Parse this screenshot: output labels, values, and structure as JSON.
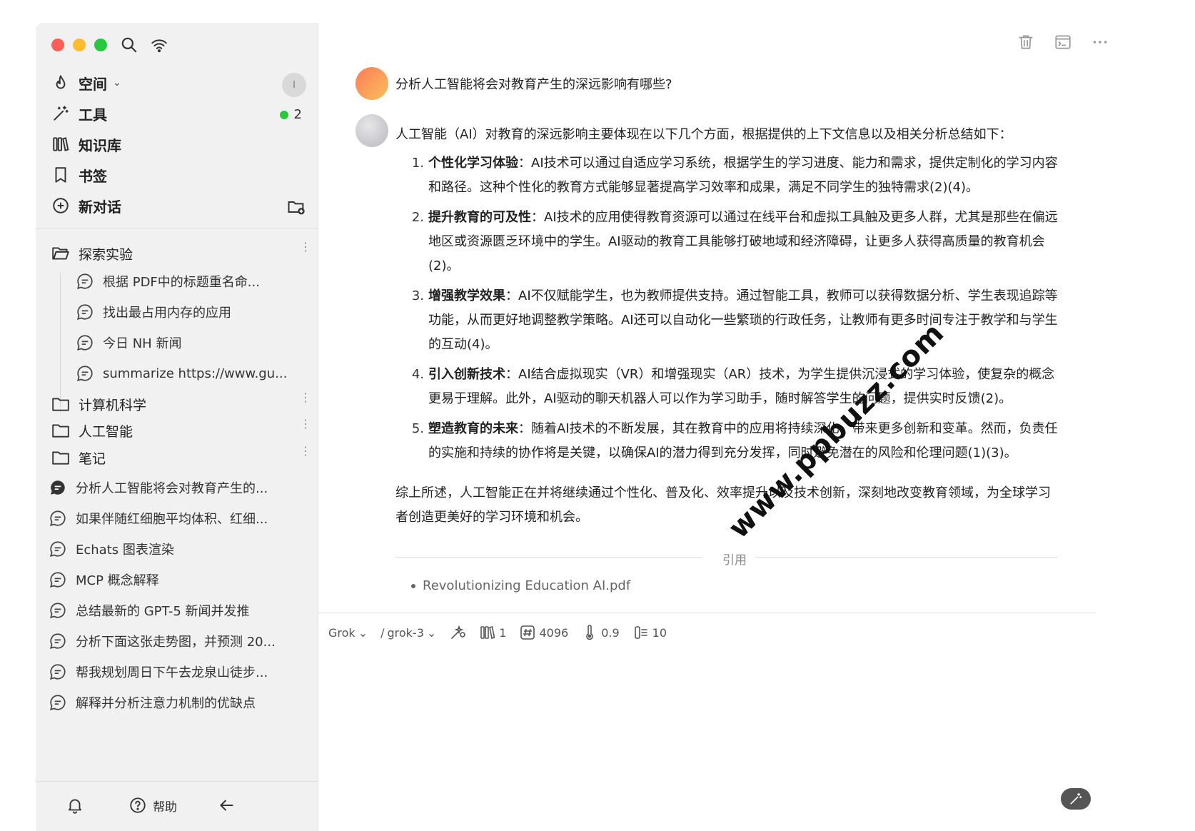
{
  "sidebar": {
    "nav": {
      "space": "空间",
      "tools": "工具",
      "knowledge": "知识库",
      "bookmarks": "书签",
      "new_chat": "新对话"
    },
    "avatar_initial": "I",
    "tools_count": "2",
    "folders": [
      {
        "name": "探索实验"
      },
      {
        "name": "计算机科学"
      },
      {
        "name": "人工智能"
      },
      {
        "name": "笔记"
      }
    ],
    "sub_chats": [
      "根据 PDF中的标题重名命...",
      "找出最占用内存的应用",
      "今日 NH 新闻",
      "summarize https://www.gu..."
    ],
    "chats": [
      "分析人工智能将会对教育产生的...",
      "如果伴随红细胞平均体积、红细...",
      "Echats 图表渲染",
      "MCP 概念解释",
      "总结最新的 GPT-5 新闻并发推",
      "分析下面这张走势图，并预测 20...",
      "帮我规划周日下午去龙泉山徒步...",
      "解释并分析注意力机制的优缺点"
    ],
    "footer": {
      "help": "帮助"
    }
  },
  "main": {
    "question": "分析人工智能将会对教育产生的深远影响有哪些?",
    "answer": {
      "intro": "人工智能（AI）对教育的深远影响主要体现在以下几个方面，根据提供的上下文信息以及相关分析总结如下：",
      "items": [
        {
          "num": "1.",
          "title": "个性化学习体验",
          "text": "：AI技术可以通过自适应学习系统，根据学生的学习进度、能力和需求，提供定制化的学习内容和路径。这种个性化的教育方式能够显著提高学习效率和成果，满足不同学生的独特需求(2)(4)。"
        },
        {
          "num": "2.",
          "title": "提升教育的可及性",
          "text": "：AI技术的应用使得教育资源可以通过在线平台和虚拟工具触及更多人群，尤其是那些在偏远地区或资源匮乏环境中的学生。AI驱动的教育工具能够打破地域和经济障碍，让更多人获得高质量的教育机会(2)。"
        },
        {
          "num": "3.",
          "title": "增强教学效果",
          "text": "：AI不仅赋能学生，也为教师提供支持。通过智能工具，教师可以获得数据分析、学生表现追踪等功能，从而更好地调整教学策略。AI还可以自动化一些繁琐的行政任务，让教师有更多时间专注于教学和与学生的互动(4)。"
        },
        {
          "num": "4.",
          "title": "引入创新技术",
          "text": "：AI结合虚拟现实（VR）和增强现实（AR）技术，为学生提供沉浸式的学习体验，使复杂的概念更易于理解。此外，AI驱动的聊天机器人可以作为学习助手，随时解答学生的问题，提供实时反馈(2)。"
        },
        {
          "num": "5.",
          "title": "塑造教育的未来",
          "text": "：随着AI技术的不断发展，其在教育中的应用将持续深化，带来更多创新和变革。然而，负责任的实施和持续的协作将是关键，以确保AI的潜力得到充分发挥，同时避免潜在的风险和伦理问题(1)(3)。"
        }
      ],
      "summary": "综上所述，人工智能正在并将继续通过个性化、普及化、效率提升以及技术创新，深刻地改变教育领域，为全球学习者创造更美好的学习环境和机会。"
    },
    "citation_label": "引用",
    "references": [
      "Revolutionizing Education AI.pdf"
    ],
    "toolbar": {
      "provider": "Grok",
      "separator": "/",
      "model": "grok-3",
      "knowledge_count": "1",
      "max_tokens": "4096",
      "temperature": "0.9",
      "context_count": "10"
    },
    "watermark": "www.ppbuzz.com"
  },
  "colors": {
    "close": "#ff5f57",
    "minimize": "#febc2e",
    "zoom": "#28c840",
    "sidebar_bg": "#f1f1f1",
    "status_green": "#28c840"
  }
}
